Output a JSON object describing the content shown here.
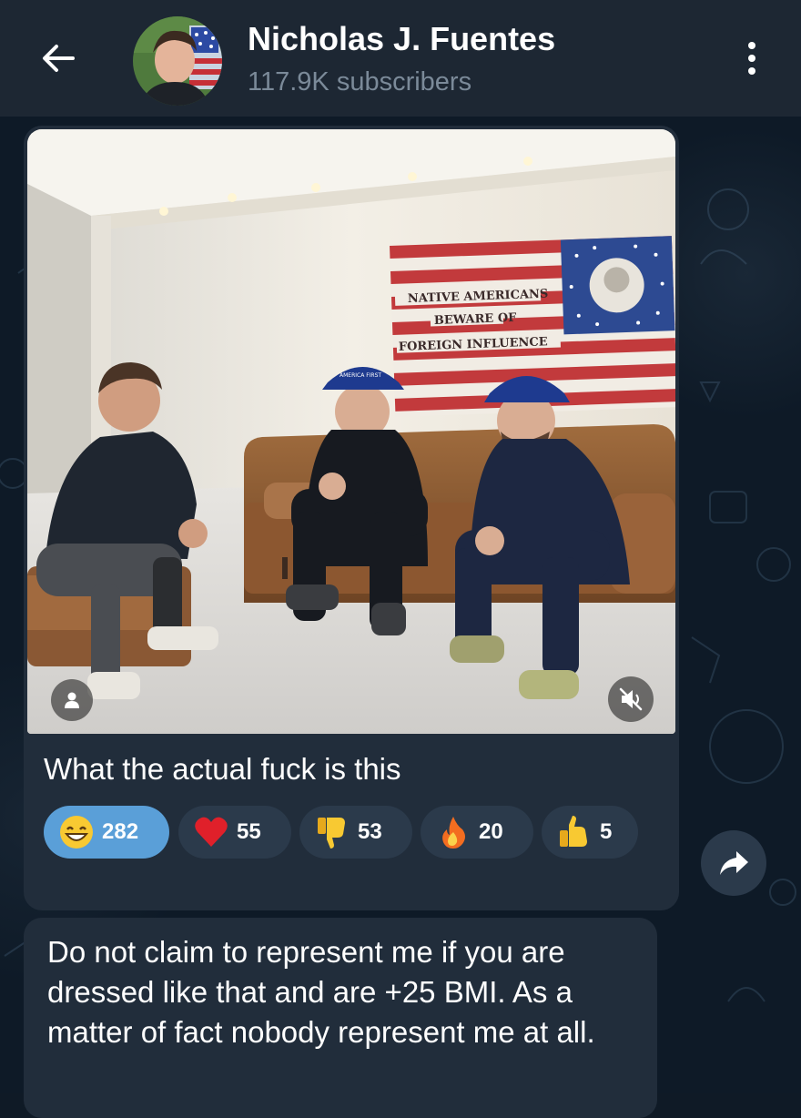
{
  "header": {
    "title": "Nicholas J. Fuentes",
    "subtitle": "117.9K subscribers",
    "back_icon": "arrow-left-icon",
    "menu_icon": "more-vertical-icon"
  },
  "messages": [
    {
      "has_photo": true,
      "photo_overlay_icons": [
        "person-icon",
        "speaker-muted-icon"
      ],
      "text": "What the actual fuck is this",
      "reactions": [
        {
          "emoji": "grinning-face",
          "count": "282",
          "selected": true
        },
        {
          "emoji": "red-heart",
          "count": "55",
          "selected": false
        },
        {
          "emoji": "thumbs-down",
          "count": "53",
          "selected": false
        },
        {
          "emoji": "fire",
          "count": "20",
          "selected": false
        },
        {
          "emoji": "thumbs-up",
          "count": "5",
          "selected": false
        }
      ]
    },
    {
      "text": "Do not claim to represent me if you are dressed like that and are +25 BMI. As a matter of fact nobody represent me at all."
    }
  ],
  "photo": {
    "flag_text": [
      "NATIVE AMERICANS",
      "BEWARE OF",
      "FOREIGN INFLUENCE"
    ],
    "cap_text": "AMERICA FIRST"
  },
  "colors": {
    "header_bg": "#1d2733",
    "bubble_bg": "#212d3b",
    "reaction_bg": "#2b3a4b",
    "reaction_selected_bg": "#5a9fd8",
    "subtitle": "#7b8a99"
  }
}
